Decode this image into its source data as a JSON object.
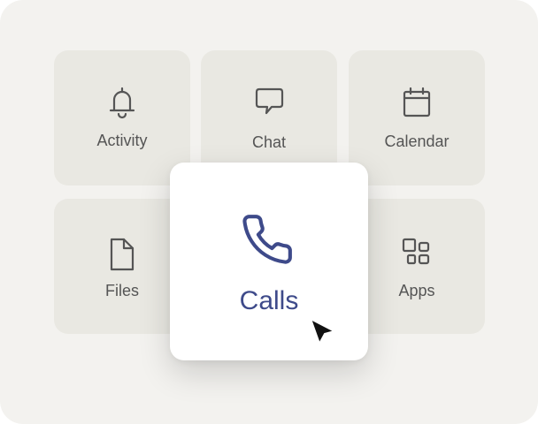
{
  "tiles": {
    "activity": {
      "label": "Activity",
      "icon": "bell-icon"
    },
    "chat": {
      "label": "Chat",
      "icon": "chat-bubble-icon"
    },
    "calendar": {
      "label": "Calendar",
      "icon": "calendar-icon"
    },
    "files": {
      "label": "Files",
      "icon": "file-icon"
    },
    "apps": {
      "label": "Apps",
      "icon": "apps-grid-icon"
    }
  },
  "selected": {
    "label": "Calls",
    "icon": "phone-icon",
    "accent_color": "#3e4a8a"
  },
  "cursor": {
    "icon": "mouse-pointer-icon"
  },
  "colors": {
    "background": "#f3f2ef",
    "tile": "#e9e8e2",
    "text": "#555555"
  }
}
